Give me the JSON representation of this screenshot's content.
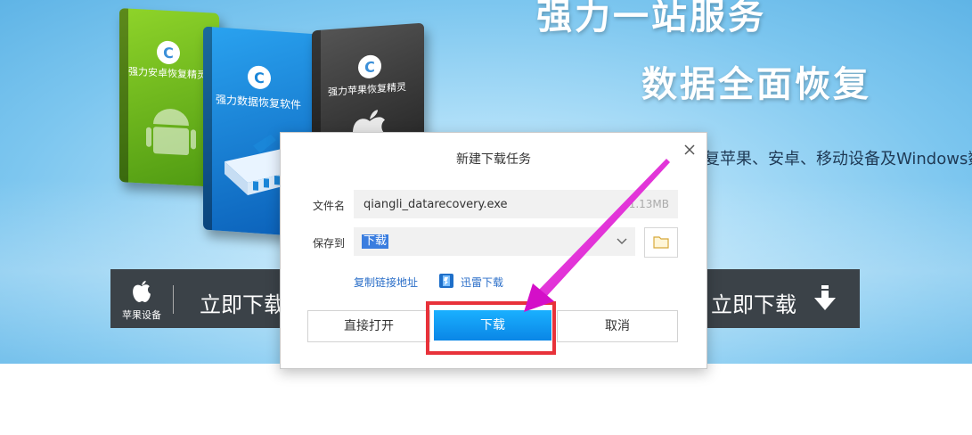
{
  "banner": {
    "headline_1": "强力一站服务",
    "headline_2": "数据全面恢复",
    "description": "复苹果、安卓、移动设备及Windows数",
    "products": [
      {
        "name": "强力安卓恢复精灵",
        "color": "#6ab81e"
      },
      {
        "name": "强力数据恢复软件",
        "color": "#1a86d8"
      },
      {
        "name": "强力苹果恢复精灵",
        "color": "#333333"
      }
    ],
    "apple_label": "苹果设备",
    "download_left": "立即下载",
    "download_right": "立即下载"
  },
  "dialog": {
    "title": "新建下载任务",
    "filename_label": "文件名",
    "filename_value": "qiangli_datarecovery.exe",
    "filesize": "1.13MB",
    "saveto_label": "保存到",
    "saveto_value": "下载",
    "copy_link": "复制链接地址",
    "thunder_download": "迅雷下载",
    "btn_open": "直接打开",
    "btn_download": "下载",
    "btn_cancel": "取消"
  },
  "colors": {
    "accent": "#0a86e6",
    "highlight_box": "#e8323a",
    "arrow": "#e21fd6",
    "link": "#2a6ec8"
  }
}
